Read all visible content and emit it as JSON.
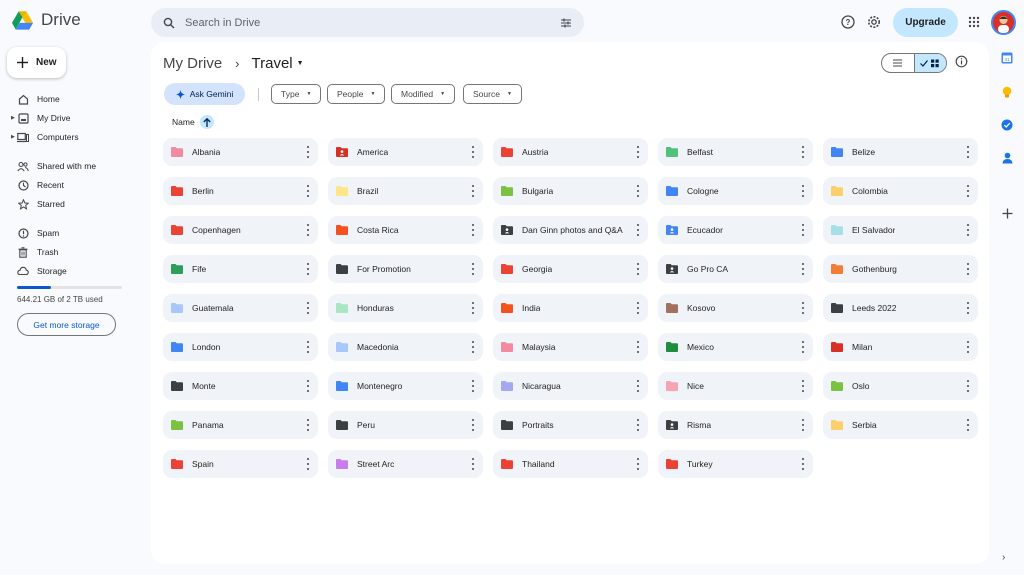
{
  "app": {
    "name": "Drive"
  },
  "header": {
    "search_placeholder": "Search in Drive",
    "upgrade_label": "Upgrade"
  },
  "sidebar": {
    "new_label": "New",
    "items": [
      {
        "label": "Home",
        "icon": "home-icon"
      },
      {
        "label": "My Drive",
        "icon": "my-drive-icon"
      },
      {
        "label": "Computers",
        "icon": "computers-icon"
      },
      {
        "label": "Shared with me",
        "icon": "shared-icon"
      },
      {
        "label": "Recent",
        "icon": "clock-icon"
      },
      {
        "label": "Starred",
        "icon": "star-icon"
      },
      {
        "label": "Spam",
        "icon": "spam-icon"
      },
      {
        "label": "Trash",
        "icon": "trash-icon"
      },
      {
        "label": "Storage",
        "icon": "cloud-icon"
      }
    ],
    "storage_used_fraction": 0.32,
    "storage_text": "644.21 GB of 2 TB used",
    "get_storage_label": "Get more storage"
  },
  "main": {
    "breadcrumb": {
      "root": "My Drive",
      "current": "Travel"
    },
    "gemini_label": "Ask Gemini",
    "filters": [
      "Type",
      "People",
      "Modified",
      "Source"
    ],
    "sort_label": "Name",
    "folders": [
      {
        "name": "Albania",
        "color": "#f28b9f",
        "shared": false
      },
      {
        "name": "America",
        "color": "#d93025",
        "shared": true
      },
      {
        "name": "Austria",
        "color": "#ea4335",
        "shared": false
      },
      {
        "name": "Belfast",
        "color": "#4fc17a",
        "shared": false
      },
      {
        "name": "Belize",
        "color": "#4285f4",
        "shared": false
      },
      {
        "name": "Berlin",
        "color": "#ea4335",
        "shared": false
      },
      {
        "name": "Brazil",
        "color": "#fde68a",
        "shared": false
      },
      {
        "name": "Bulgaria",
        "color": "#7cc242",
        "shared": false
      },
      {
        "name": "Cologne",
        "color": "#4285f4",
        "shared": false
      },
      {
        "name": "Colombia",
        "color": "#fbd06b",
        "shared": false
      },
      {
        "name": "Copenhagen",
        "color": "#ea4335",
        "shared": false
      },
      {
        "name": "Costa Rica",
        "color": "#f4511e",
        "shared": false
      },
      {
        "name": "Dan Ginn photos and Q&A",
        "color": "#3c4043",
        "shared": true
      },
      {
        "name": "Ecucador",
        "color": "#4285f4",
        "shared": true
      },
      {
        "name": "El Salvador",
        "color": "#a6dfe8",
        "shared": false
      },
      {
        "name": "Fife",
        "color": "#2e9e5b",
        "shared": false
      },
      {
        "name": "For Promotion",
        "color": "#3c4043",
        "shared": false
      },
      {
        "name": "Georgia",
        "color": "#ea4335",
        "shared": false
      },
      {
        "name": "Go Pro CA",
        "color": "#3c4043",
        "shared": true
      },
      {
        "name": "Gothenburg",
        "color": "#f57c35",
        "shared": false
      },
      {
        "name": "Guatemala",
        "color": "#a8c7fa",
        "shared": false
      },
      {
        "name": "Honduras",
        "color": "#a8e6c4",
        "shared": false
      },
      {
        "name": "India",
        "color": "#f4511e",
        "shared": false
      },
      {
        "name": "Kosovo",
        "color": "#a1705f",
        "shared": false
      },
      {
        "name": "Leeds 2022",
        "color": "#3c4043",
        "shared": false
      },
      {
        "name": "London",
        "color": "#4285f4",
        "shared": false
      },
      {
        "name": "Macedonia",
        "color": "#a8c7fa",
        "shared": false
      },
      {
        "name": "Malaysia",
        "color": "#f28b9f",
        "shared": false
      },
      {
        "name": "Mexico",
        "color": "#1e8e3e",
        "shared": false
      },
      {
        "name": "Milan",
        "color": "#d93025",
        "shared": false
      },
      {
        "name": "Monte",
        "color": "#3c4043",
        "shared": false
      },
      {
        "name": "Montenegro",
        "color": "#4285f4",
        "shared": false
      },
      {
        "name": "Nicaragua",
        "color": "#a3a8f0",
        "shared": false
      },
      {
        "name": "Nice",
        "color": "#f6a4b4",
        "shared": false
      },
      {
        "name": "Oslo",
        "color": "#7cc242",
        "shared": false
      },
      {
        "name": "Panama",
        "color": "#7cc242",
        "shared": false
      },
      {
        "name": "Peru",
        "color": "#3c4043",
        "shared": false
      },
      {
        "name": "Portraits",
        "color": "#3c4043",
        "shared": false
      },
      {
        "name": "Risma",
        "color": "#3c4043",
        "shared": true
      },
      {
        "name": "Serbia",
        "color": "#fbd06b",
        "shared": false
      },
      {
        "name": "Spain",
        "color": "#ea4335",
        "shared": false
      },
      {
        "name": "Street Arc",
        "color": "#c77dea",
        "shared": false
      },
      {
        "name": "Thailand",
        "color": "#ea4335",
        "shared": false
      },
      {
        "name": "Turkey",
        "color": "#ea4335",
        "shared": false
      }
    ]
  },
  "right_rail": {
    "icons": [
      "calendar-icon",
      "keep-icon",
      "tasks-icon",
      "contacts-icon",
      "add-icon"
    ],
    "calendar_day": "31"
  },
  "colors": {
    "accent": "#0b57d0",
    "chip_blue": "#c2e7ff",
    "folder_bg": "#f0f4f9"
  }
}
